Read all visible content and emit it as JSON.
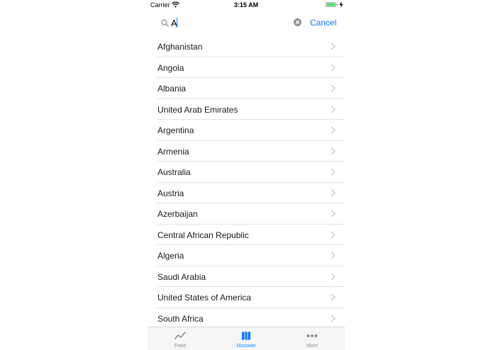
{
  "status_bar": {
    "carrier": "Carrier",
    "time": "3:15 AM"
  },
  "search": {
    "query": "A",
    "cancel_label": "Cancel"
  },
  "countries": [
    "Afghanistan",
    "Angola",
    "Albania",
    "United Arab Emirates",
    "Argentina",
    "Armenia",
    "Australia",
    "Austria",
    "Azerbaijan",
    "Central African Republic",
    "Algeria",
    "Saudi Arabia",
    "United States of America",
    "South Africa"
  ],
  "tabs": [
    {
      "label": "Feed",
      "icon": "chart-line-icon",
      "active": false
    },
    {
      "label": "Discover",
      "icon": "map-icon",
      "active": true
    },
    {
      "label": "More",
      "icon": "more-dots-icon",
      "active": false
    }
  ],
  "colors": {
    "accent": "#0a7aff",
    "inactive": "#8e8e93",
    "battery": "#4cd964"
  }
}
